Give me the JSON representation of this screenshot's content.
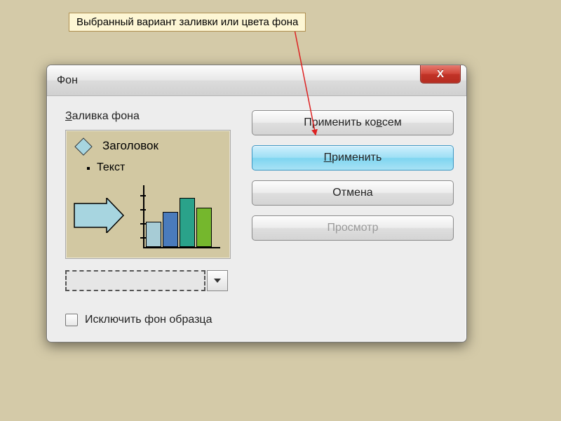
{
  "callout": {
    "text": "Выбранный вариант заливки или цвета фона"
  },
  "dialog": {
    "title": "Фон",
    "group_label_pre": "З",
    "group_label_rest": "аливка фона",
    "preview": {
      "title": "Заголовок",
      "bullet": "Текст"
    },
    "buttons": {
      "apply_all_pre": "Применить ко ",
      "apply_all_u": "в",
      "apply_all_post": "сем",
      "apply_pre": "",
      "apply_u": "П",
      "apply_post": "рименить",
      "cancel": "Отмена",
      "preview": "Просмотр"
    },
    "checkbox": {
      "label": "Исключить фон образца",
      "checked": false
    }
  },
  "colors": {
    "bar1": "#a7ccd6",
    "bar2": "#4a7bbc",
    "bar3": "#2aa28a",
    "bar4": "#75b72d"
  }
}
